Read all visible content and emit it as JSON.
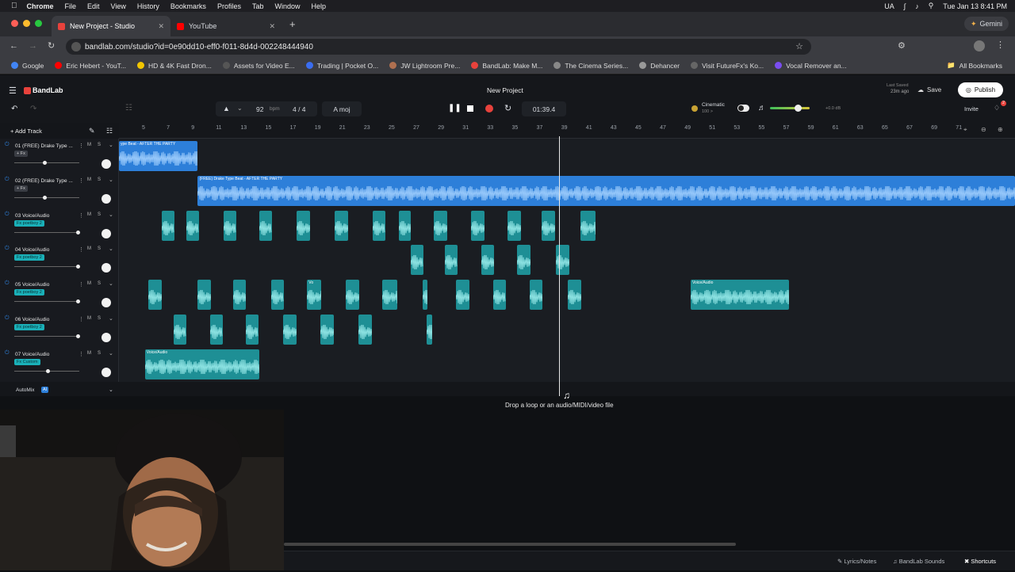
{
  "mac_menu": {
    "app": "Chrome",
    "items": [
      "File",
      "Edit",
      "View",
      "History",
      "Bookmarks",
      "Profiles",
      "Tab",
      "Window",
      "Help"
    ],
    "locale": "UA",
    "datetime": "Tue Jan 13  8:41 PM",
    "gemini": "Gemini"
  },
  "browser": {
    "tabs": [
      {
        "label": "New Project - Studio"
      },
      {
        "label": "YouTube"
      }
    ],
    "url": "bandlab.com/studio?id=0e90dd10-eff0-f011-8d4d-002248444940",
    "bookmarks": [
      "Google",
      "Eric Hebert - YouT...",
      "HD & 4K Fast Dron...",
      "Assets for Video E...",
      "Trading | Pocket O...",
      "JW Lightroom Pre...",
      "BandLab: Make M...",
      "The Cinema Series...",
      "Dehancer",
      "Visit FutureFx's Ko...",
      "Vocal Remover an..."
    ],
    "all_bookmarks": "All Bookmarks"
  },
  "studio": {
    "brand": "BandLab",
    "project_title": "New Project",
    "last_saved": "Last Saved",
    "last_saved_ago": "23m ago",
    "save_label": "Save",
    "publish_label": "Publish",
    "bpm_value": "92",
    "bpm_unit": "bpm",
    "time_sig": "4 / 4",
    "key": "A moj",
    "time": "01:39.4",
    "preset_name": "Cinematic",
    "preset_sub": "100 >",
    "volume_db": "+0.0 dB",
    "invite_label": "Invite",
    "notification_count": "2",
    "add_track_label": "+ Add Track",
    "automix_label": "AutoMix",
    "automix_badge": "AI",
    "drop_hint": "Drop a loop or an audio/MIDI/video file",
    "ruler_ticks": [
      "5",
      "7",
      "9",
      "11",
      "13",
      "15",
      "17",
      "19",
      "21",
      "23",
      "25",
      "27",
      "29",
      "31",
      "33",
      "35",
      "37",
      "39",
      "41",
      "43",
      "45",
      "47",
      "49",
      "51",
      "53",
      "55",
      "57",
      "59",
      "61",
      "63",
      "65",
      "67",
      "69",
      "71"
    ]
  },
  "tracks": [
    {
      "name": "01  (FREE) Drake Type ...",
      "fx": "+ Fx",
      "fx_color": "#3a3d44",
      "fader": 0.45,
      "clips": [
        {
          "label": "ype Beat - AFTER THE PARTY",
          "start": 0.0,
          "end": 0.088,
          "color": "blue"
        }
      ]
    },
    {
      "name": "02  (FREE) Drake Type ...",
      "fx": "+ Fx",
      "fx_color": "#3a3d44",
      "fader": 0.45,
      "clips": [
        {
          "label": "(FREE) Drake Type Beat - AFTER THE PARTY",
          "start": 0.088,
          "end": 1.0,
          "color": "blue"
        }
      ]
    },
    {
      "name": "03  Voice/Audio",
      "fx": "Fx  poetboy 2",
      "fx_color": "#1ab0b8",
      "fader": 0.98,
      "clips": [
        {
          "label": "",
          "start": 0.048,
          "end": 0.062
        },
        {
          "label": "",
          "start": 0.075,
          "end": 0.089
        },
        {
          "label": "",
          "start": 0.117,
          "end": 0.131
        },
        {
          "label": "",
          "start": 0.157,
          "end": 0.171
        },
        {
          "label": "",
          "start": 0.198,
          "end": 0.213
        },
        {
          "label": "",
          "start": 0.241,
          "end": 0.256
        },
        {
          "label": "",
          "start": 0.283,
          "end": 0.297
        },
        {
          "label": "",
          "start": 0.312,
          "end": 0.326
        },
        {
          "label": "",
          "start": 0.351,
          "end": 0.366
        },
        {
          "label": "",
          "start": 0.393,
          "end": 0.408
        },
        {
          "label": "",
          "start": 0.434,
          "end": 0.449
        },
        {
          "label": "",
          "start": 0.472,
          "end": 0.487
        },
        {
          "label": "",
          "start": 0.515,
          "end": 0.532
        }
      ]
    },
    {
      "name": "04  Voice/Audio",
      "fx": "Fx  poetboy 2",
      "fx_color": "#1ab0b8",
      "fader": 0.98,
      "clips": [
        {
          "label": "",
          "start": 0.326,
          "end": 0.34
        },
        {
          "label": "",
          "start": 0.364,
          "end": 0.378
        },
        {
          "label": "",
          "start": 0.404,
          "end": 0.419
        },
        {
          "label": "",
          "start": 0.444,
          "end": 0.459
        },
        {
          "label": "",
          "start": 0.488,
          "end": 0.503
        }
      ]
    },
    {
      "name": "05  Voice/Audio",
      "fx": "Fx  poetboy 2",
      "fx_color": "#1ab0b8",
      "fader": 0.98,
      "clips": [
        {
          "label": "",
          "start": 0.033,
          "end": 0.048
        },
        {
          "label": "",
          "start": 0.088,
          "end": 0.103
        },
        {
          "label": "",
          "start": 0.127,
          "end": 0.142
        },
        {
          "label": "",
          "start": 0.17,
          "end": 0.184
        },
        {
          "label": "Vo",
          "start": 0.21,
          "end": 0.226
        },
        {
          "label": "",
          "start": 0.253,
          "end": 0.268
        },
        {
          "label": "",
          "start": 0.294,
          "end": 0.311
        },
        {
          "label": "",
          "start": 0.339,
          "end": 0.344
        },
        {
          "label": "",
          "start": 0.376,
          "end": 0.391
        },
        {
          "label": "",
          "start": 0.418,
          "end": 0.432
        },
        {
          "label": "",
          "start": 0.458,
          "end": 0.473
        },
        {
          "label": "",
          "start": 0.501,
          "end": 0.516
        },
        {
          "label": "Voice/Audio",
          "start": 0.638,
          "end": 0.748
        }
      ]
    },
    {
      "name": "06  Voice/Audio",
      "fx": "Fx  poetboy 2",
      "fx_color": "#1ab0b8",
      "fader": 0.98,
      "clips": [
        {
          "label": "",
          "start": 0.061,
          "end": 0.075
        },
        {
          "label": "",
          "start": 0.102,
          "end": 0.116
        },
        {
          "label": "",
          "start": 0.142,
          "end": 0.156
        },
        {
          "label": "",
          "start": 0.183,
          "end": 0.198
        },
        {
          "label": "",
          "start": 0.225,
          "end": 0.24
        },
        {
          "label": "",
          "start": 0.267,
          "end": 0.282
        },
        {
          "label": "",
          "start": 0.343,
          "end": 0.35
        }
      ]
    },
    {
      "name": "07  Voice/Audio",
      "fx": "Fx  Custom",
      "fx_color": "#1ab0b8",
      "fader": 0.5,
      "clips": [
        {
          "label": "Voice/Audio",
          "start": 0.029,
          "end": 0.157
        }
      ]
    }
  ],
  "status_bar": {
    "lyrics": "Lyrics/Notes",
    "sounds": "BandLab Sounds",
    "shortcuts": "Shortcuts"
  },
  "colors": {
    "accent": "#e8423c",
    "clip_blue": "#2d7fd9",
    "clip_teal": "#1e8f95",
    "fx_teal": "#1ab0b8"
  }
}
